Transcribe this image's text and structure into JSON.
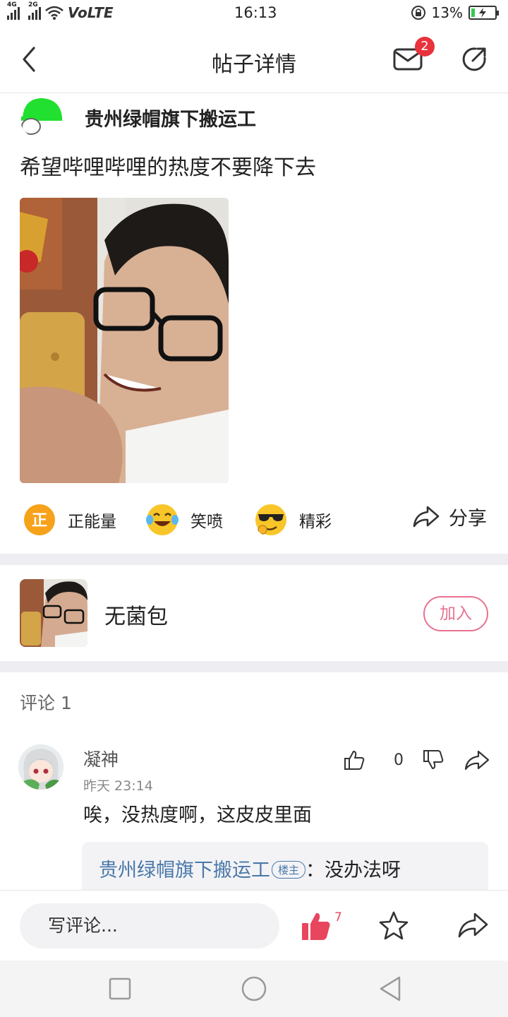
{
  "status_bar": {
    "signal_1": "4G",
    "signal_2": "2G",
    "network": "VoLTE",
    "time": "16:13",
    "battery": "13%"
  },
  "nav": {
    "title": "帖子详情",
    "message_badge": "2"
  },
  "post": {
    "author": "贵州绿帽旗下搬运工",
    "text": "希望哔哩哔哩的热度不要降下去",
    "avatar_color": "#22e030"
  },
  "reactions": [
    {
      "label": "正能量",
      "icon": "positive-energy-icon",
      "glyph": "正"
    },
    {
      "label": "笑喷",
      "icon": "laugh-icon"
    },
    {
      "label": "精彩",
      "icon": "cool-sunglasses-icon"
    }
  ],
  "share": {
    "label": "分享"
  },
  "circle": {
    "name": "无菌包",
    "join_label": "加入",
    "accent": "#e8728f"
  },
  "comments": {
    "header": "评论 1",
    "items": [
      {
        "user": "凝神",
        "time": "昨天 23:14",
        "text": "唉，没热度啊，这皮皮里面",
        "likes": "0",
        "reply": {
          "user": "贵州绿帽旗下搬运工",
          "badge": "楼主",
          "separator": "：",
          "text": "没办法呀"
        }
      }
    ]
  },
  "bottom_bar": {
    "placeholder": "写评论...",
    "like_count": "7",
    "like_color": "#e8465e"
  }
}
